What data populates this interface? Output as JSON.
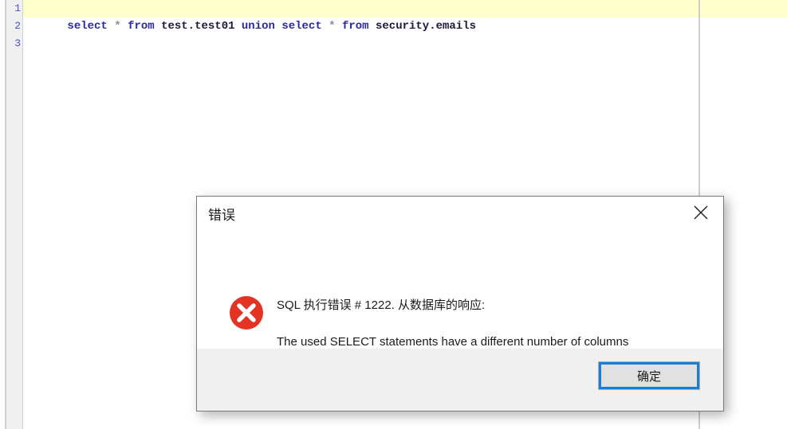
{
  "editor": {
    "line_numbers": [
      "1",
      "2",
      "3"
    ],
    "lines": [
      {
        "tokens": [
          {
            "text": "select",
            "kind": "kw"
          },
          {
            "text": " ",
            "kind": "plain"
          },
          {
            "text": "*",
            "kind": "star"
          },
          {
            "text": " ",
            "kind": "plain"
          },
          {
            "text": "from",
            "kind": "kw"
          },
          {
            "text": " ",
            "kind": "plain"
          },
          {
            "text": "test.test01",
            "kind": "id"
          },
          {
            "text": " ",
            "kind": "plain"
          },
          {
            "text": "union",
            "kind": "kw"
          },
          {
            "text": " ",
            "kind": "plain"
          },
          {
            "text": "select",
            "kind": "kw"
          },
          {
            "text": " ",
            "kind": "plain"
          },
          {
            "text": "*",
            "kind": "star"
          },
          {
            "text": " ",
            "kind": "plain"
          },
          {
            "text": "from",
            "kind": "kw"
          },
          {
            "text": " ",
            "kind": "plain"
          },
          {
            "text": "security.emails",
            "kind": "id"
          }
        ],
        "plain": "select * from test.test01 union select * from security.emails",
        "current": true
      },
      {
        "tokens": [],
        "plain": "",
        "current": false
      },
      {
        "tokens": [],
        "plain": "",
        "current": false
      }
    ],
    "colors": {
      "current_line_highlight": "#ffffcc",
      "keyword": "#2a2a9c",
      "identifier": "#1a1a3a",
      "star": "#8f8f8f",
      "line_number": "#4a4fbf",
      "gutter_background": "#f0f0f0",
      "margin_guide": "#cfcfcf"
    }
  },
  "dialog": {
    "title": "错误",
    "close_icon": "close-icon",
    "error_icon": "error-circle-x-icon",
    "message_line1": "SQL 执行错误 # 1222. 从数据库的响应:",
    "message_line2": "The used SELECT statements have a different number of columns",
    "ok_label": "确定",
    "colors": {
      "error_red": "#e33322",
      "focus_blue": "#1a7fd4",
      "footer_background": "#f0f0f0",
      "border": "#7a7a7a",
      "button_face": "#e1e1e1"
    }
  }
}
